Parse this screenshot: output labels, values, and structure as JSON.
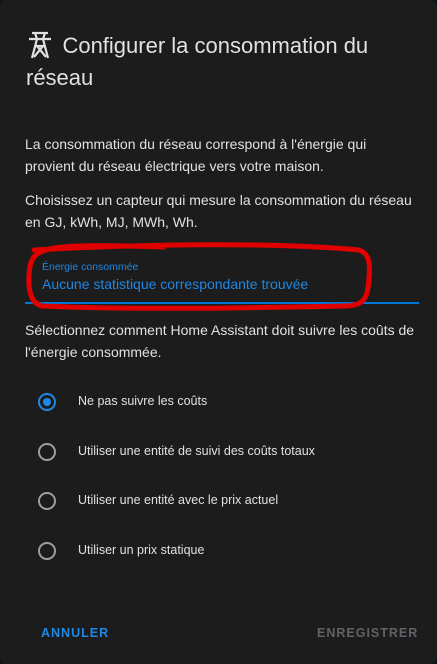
{
  "dialog": {
    "title_line1": "Configurer la consommation du",
    "title_line2": "réseau",
    "icon": "transmission-tower-icon",
    "description": "La consommation du réseau correspond à l'énergie qui provient du réseau électrique vers votre maison.",
    "sensor_prompt": "Choisissez un capteur qui mesure la consommation du réseau en GJ, kWh, MJ, MWh, Wh."
  },
  "field": {
    "label": "Énergie consommée",
    "value": "Aucune statistique correspondante trouvée",
    "accent_color": "#1e88e5"
  },
  "cost": {
    "prompt": "Sélectionnez comment Home Assistant doit suivre les coûts de l'énergie consommée.",
    "options": [
      {
        "label": "Ne pas suivre les coûts",
        "checked": true
      },
      {
        "label": "Utiliser une entité de suivi des coûts totaux",
        "checked": false
      },
      {
        "label": "Utiliser une entité avec le prix actuel",
        "checked": false
      },
      {
        "label": "Utiliser un prix statique",
        "checked": false
      }
    ]
  },
  "actions": {
    "cancel": "ANNULER",
    "save": "ENREGISTRER"
  },
  "colors": {
    "background": "#1c1c1c",
    "annotation": "#e00000"
  }
}
